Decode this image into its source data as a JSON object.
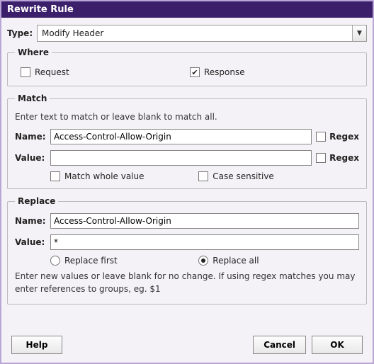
{
  "window": {
    "title": "Rewrite Rule"
  },
  "type": {
    "label": "Type:",
    "value": "Modify Header"
  },
  "where": {
    "legend": "Where",
    "request": {
      "label": "Request",
      "checked": false
    },
    "response": {
      "label": "Response",
      "checked": true
    }
  },
  "match": {
    "legend": "Match",
    "helper": "Enter text to match or leave blank to match all.",
    "name_label": "Name:",
    "name_value": "Access-Control-Allow-Origin",
    "name_regex": {
      "label": "Regex",
      "checked": false
    },
    "value_label": "Value:",
    "value_value": "",
    "value_regex": {
      "label": "Regex",
      "checked": false
    },
    "match_whole": {
      "label": "Match whole value",
      "checked": false
    },
    "case_sensitive": {
      "label": "Case sensitive",
      "checked": false
    }
  },
  "replace": {
    "legend": "Replace",
    "name_label": "Name:",
    "name_value": "Access-Control-Allow-Origin",
    "value_label": "Value:",
    "value_value": "*",
    "replace_first": {
      "label": "Replace first",
      "checked": false
    },
    "replace_all": {
      "label": "Replace all",
      "checked": true
    },
    "helper": "Enter new values or leave blank for no change. If using regex matches you may enter references to groups, eg. $1"
  },
  "buttons": {
    "help": "Help",
    "cancel": "Cancel",
    "ok": "OK"
  }
}
